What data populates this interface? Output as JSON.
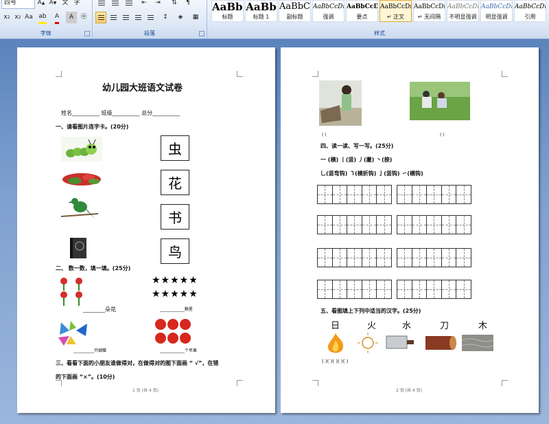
{
  "ribbon": {
    "font_group_label": "字体",
    "paragraph_group_label": "段落",
    "styles_group_label": "样式",
    "font_size_value": "四号",
    "styles": [
      {
        "sample": "AaBbC",
        "name": "标题"
      },
      {
        "sample": "AaBb",
        "name": "标题 1"
      },
      {
        "sample": "AaBbC",
        "name": "副标题"
      },
      {
        "sample": "AaBbCcDı",
        "name": "强调"
      },
      {
        "sample": "AaBbCcD",
        "name": "要点"
      },
      {
        "sample": "AaBbCcDı",
        "name": "↵ 正文"
      },
      {
        "sample": "AaBbCcDı",
        "name": "↵ 无间隔"
      },
      {
        "sample": "AaBbCcDı",
        "name": "不明显强调"
      },
      {
        "sample": "AaBbCcDı",
        "name": "明显强调"
      },
      {
        "sample": "AaBbCcDı",
        "name": "引用"
      }
    ]
  },
  "page1": {
    "title": "幼儿园大班语文试卷",
    "fields": "姓名__________     班级__________     总分__________",
    "q1": "一、请看图片连字卡。(20分)",
    "cards": [
      "虫",
      "花",
      "书",
      "鸟"
    ],
    "q2": "二、   数一数，填一填。(25分)",
    "stars_row": "★★★★★",
    "blank_flowers": "________朵花",
    "blank_stars": "____________颗星",
    "blank_butterflies": "__________只蝴蝶",
    "blank_apples": "____________个苹果",
    "q3_line1": "三、看看下面的小朋友谁做得对，在做得对的图下面画 “ √”，在错",
    "q3_line2": "的下面画 “×”。(10分)",
    "footer": "1 页 (共 4 页)"
  },
  "page2": {
    "brackets_top": [
      "(          )",
      "(          )"
    ],
    "q4": "四、读一读、写一写。(25分)",
    "strokes_line1": "一 (横)     丨(竖)     丿(撇)       丶(捺)",
    "strokes_line2": "乚(竖弯钩) ㇕(横折钩) 亅(竖钩)   ㇀(横钩)",
    "q5": "五、看图填上下列中适当的汉字。(25分)",
    "chars": [
      "日",
      "火",
      "水",
      "刀",
      "木"
    ],
    "answer_brackets": "(              )(          )(           )(           )(           )",
    "footer": "2 页 (共 4 页)"
  }
}
